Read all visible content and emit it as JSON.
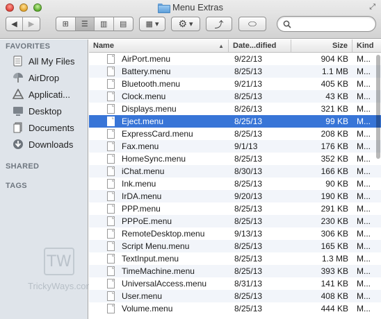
{
  "window": {
    "title": "Menu Extras"
  },
  "toolbar": {
    "back_glyph": "◀",
    "forward_glyph": "▶",
    "view_icons": "⊞",
    "view_list": "☰",
    "view_columns": "▥",
    "view_coverflow": "▤",
    "arrange_glyph": "▦",
    "action_glyph": "⚙",
    "share_glyph": "⤴",
    "tag_glyph": "⬭",
    "dropdown_glyph": "▾"
  },
  "search": {
    "value": "",
    "placeholder": ""
  },
  "sidebar": {
    "favorites_header": "FAVORITES",
    "favorites": [
      {
        "label": "All My Files",
        "icon": "all-files-icon"
      },
      {
        "label": "AirDrop",
        "icon": "airdrop-icon"
      },
      {
        "label": "Applicati...",
        "icon": "applications-icon"
      },
      {
        "label": "Desktop",
        "icon": "desktop-icon"
      },
      {
        "label": "Documents",
        "icon": "documents-icon"
      },
      {
        "label": "Downloads",
        "icon": "downloads-icon"
      }
    ],
    "shared_header": "SHARED",
    "tags_header": "TAGS",
    "watermark_badge": "TW",
    "watermark_text": "TrickyWays.com"
  },
  "list": {
    "columns": {
      "name": "Name",
      "date": "Date...dified",
      "size": "Size",
      "kind": "Kind"
    },
    "sort_glyph": "▲",
    "selected_index": 5,
    "rows": [
      {
        "name": "AirPort.menu",
        "date": "9/22/13",
        "size": "904 KB",
        "kind": "M..."
      },
      {
        "name": "Battery.menu",
        "date": "8/25/13",
        "size": "1.1 MB",
        "kind": "M..."
      },
      {
        "name": "Bluetooth.menu",
        "date": "9/21/13",
        "size": "405 KB",
        "kind": "M..."
      },
      {
        "name": "Clock.menu",
        "date": "8/25/13",
        "size": "43 KB",
        "kind": "M..."
      },
      {
        "name": "Displays.menu",
        "date": "8/26/13",
        "size": "321 KB",
        "kind": "M..."
      },
      {
        "name": "Eject.menu",
        "date": "8/25/13",
        "size": "99 KB",
        "kind": "M..."
      },
      {
        "name": "ExpressCard.menu",
        "date": "8/25/13",
        "size": "208 KB",
        "kind": "M..."
      },
      {
        "name": "Fax.menu",
        "date": "9/1/13",
        "size": "176 KB",
        "kind": "M..."
      },
      {
        "name": "HomeSync.menu",
        "date": "8/25/13",
        "size": "352 KB",
        "kind": "M..."
      },
      {
        "name": "iChat.menu",
        "date": "8/30/13",
        "size": "166 KB",
        "kind": "M..."
      },
      {
        "name": "Ink.menu",
        "date": "8/25/13",
        "size": "90 KB",
        "kind": "M..."
      },
      {
        "name": "IrDA.menu",
        "date": "9/20/13",
        "size": "190 KB",
        "kind": "M..."
      },
      {
        "name": "PPP.menu",
        "date": "8/25/13",
        "size": "291 KB",
        "kind": "M..."
      },
      {
        "name": "PPPoE.menu",
        "date": "8/25/13",
        "size": "230 KB",
        "kind": "M..."
      },
      {
        "name": "RemoteDesktop.menu",
        "date": "9/13/13",
        "size": "306 KB",
        "kind": "M..."
      },
      {
        "name": "Script Menu.menu",
        "date": "8/25/13",
        "size": "165 KB",
        "kind": "M..."
      },
      {
        "name": "TextInput.menu",
        "date": "8/25/13",
        "size": "1.3 MB",
        "kind": "M..."
      },
      {
        "name": "TimeMachine.menu",
        "date": "8/25/13",
        "size": "393 KB",
        "kind": "M..."
      },
      {
        "name": "UniversalAccess.menu",
        "date": "8/31/13",
        "size": "141 KB",
        "kind": "M..."
      },
      {
        "name": "User.menu",
        "date": "8/25/13",
        "size": "408 KB",
        "kind": "M..."
      },
      {
        "name": "Volume.menu",
        "date": "8/25/13",
        "size": "444 KB",
        "kind": "M..."
      }
    ]
  },
  "colors": {
    "selection": "#3875d7",
    "sidebar_bg": "#dfe4ea",
    "zebra": "#f2f5fa"
  }
}
